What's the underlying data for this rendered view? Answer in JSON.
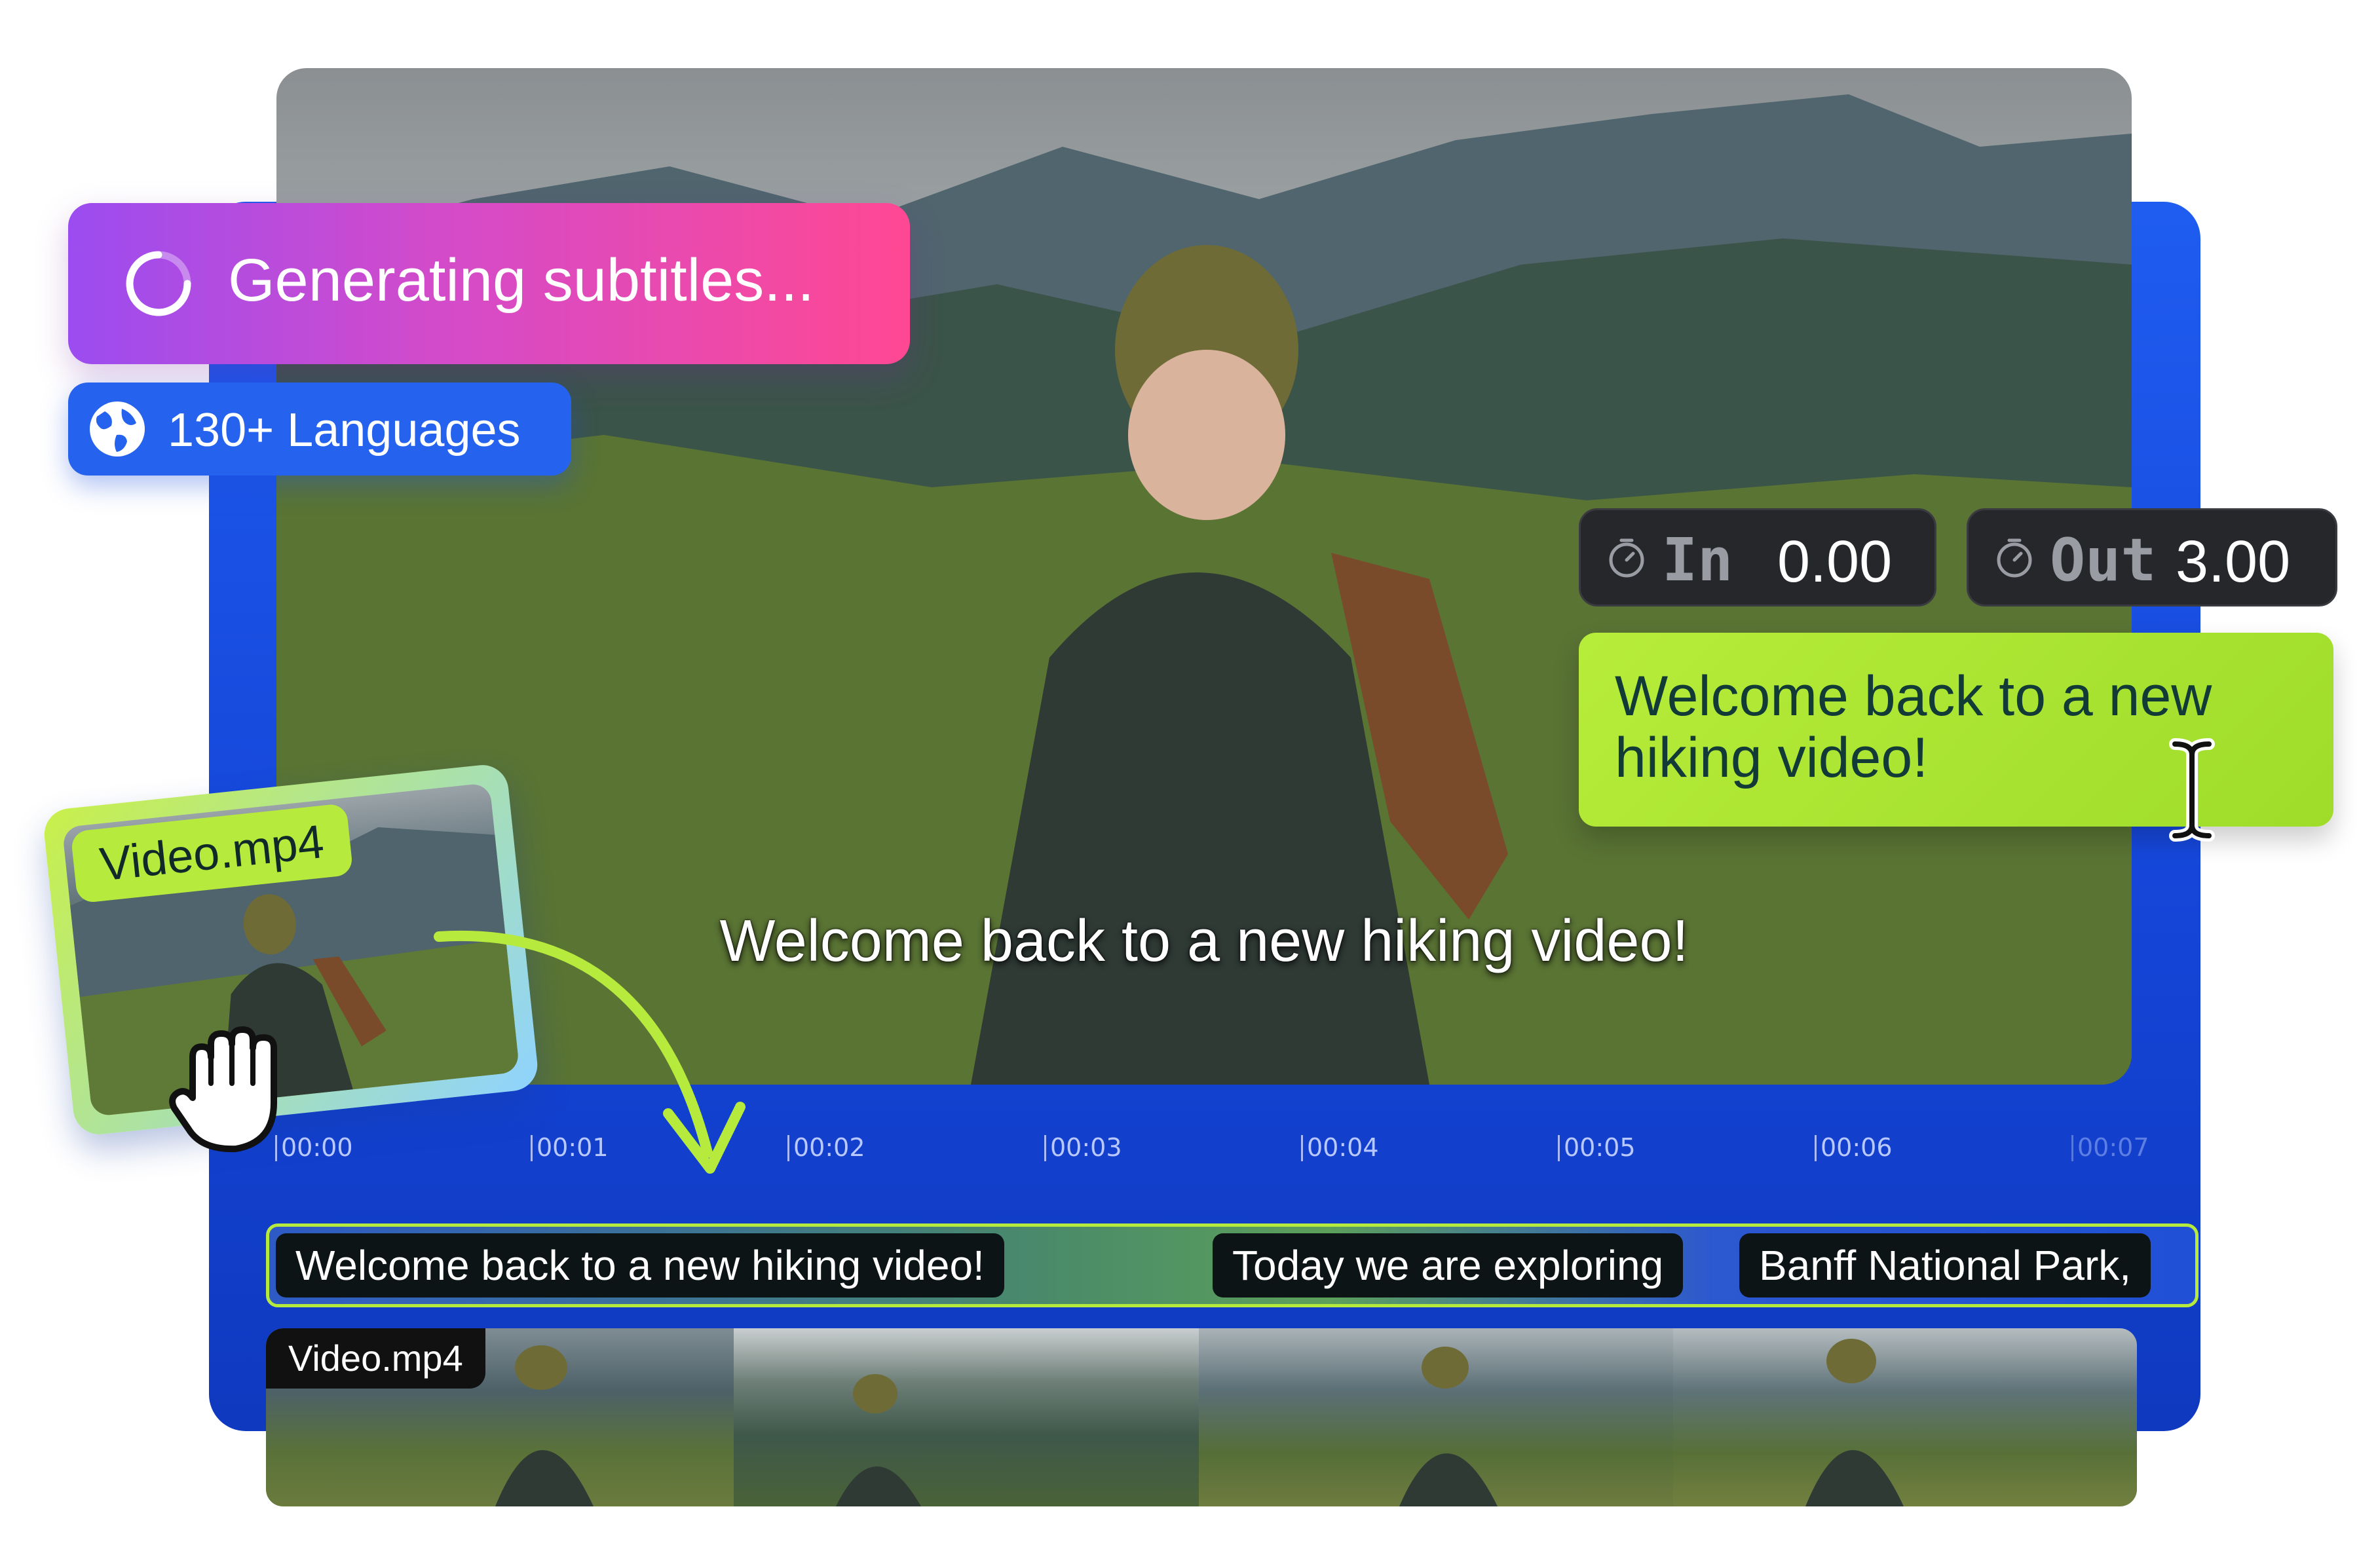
{
  "status": {
    "generating_label": "Generating subtitles...",
    "languages_label": "130+ Languages"
  },
  "preview": {
    "subtitle": "Welcome back to a new hiking video!"
  },
  "timecodes": {
    "in_label": "In",
    "in_value": "0.00",
    "out_label": "Out",
    "out_value": "3.00"
  },
  "editor": {
    "subtitle_text": "Welcome back to a new hiking video!"
  },
  "file_card": {
    "filename": "Video.mp4"
  },
  "timeline": {
    "ticks": [
      "00:00",
      "00:01",
      "00:02",
      "00:03",
      "00:04",
      "00:05",
      "00:06",
      "00:07"
    ]
  },
  "caption_track": {
    "captions": [
      "Welcome back to a new hiking video!",
      "Today we are exploring",
      "Banff National Park,"
    ]
  },
  "video_strip": {
    "label": "Video.mp4"
  },
  "colors": {
    "panel_blue": "#1f5cf0",
    "accent_green": "#b6ea3c",
    "pill_gradient_start": "#9b4cf0",
    "pill_gradient_end": "#ff4893"
  }
}
